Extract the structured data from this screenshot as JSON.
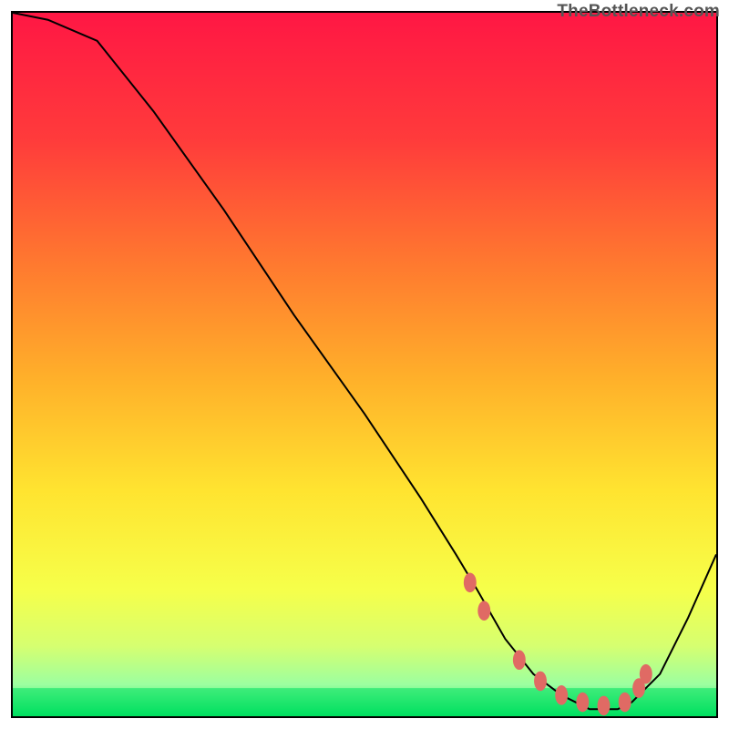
{
  "watermark": "TheBottleneck.com",
  "chart_data": {
    "type": "line",
    "title": "",
    "xlabel": "",
    "ylabel": "",
    "xlim": [
      0,
      100
    ],
    "ylim": [
      0,
      100
    ],
    "grid": false,
    "curve": {
      "name": "bottleneck-curve",
      "color": "#000000",
      "x": [
        0,
        5,
        12,
        20,
        30,
        40,
        50,
        58,
        63,
        66,
        70,
        74,
        78,
        82,
        86,
        88,
        92,
        96,
        100
      ],
      "y": [
        100,
        99,
        96,
        86,
        72,
        57,
        43,
        31,
        23,
        18,
        11,
        6,
        3,
        1,
        1,
        2,
        6,
        14,
        23
      ]
    },
    "highlight_band": {
      "name": "optimal-zone",
      "color": "#00e060",
      "y_range": [
        0,
        4
      ]
    },
    "markers": {
      "name": "sweet-spot-markers",
      "color": "#e06a64",
      "points": [
        {
          "x": 65,
          "y": 19
        },
        {
          "x": 67,
          "y": 15
        },
        {
          "x": 72,
          "y": 8
        },
        {
          "x": 75,
          "y": 5
        },
        {
          "x": 78,
          "y": 3
        },
        {
          "x": 81,
          "y": 2
        },
        {
          "x": 84,
          "y": 1.5
        },
        {
          "x": 87,
          "y": 2
        },
        {
          "x": 89,
          "y": 4
        },
        {
          "x": 90,
          "y": 6
        }
      ]
    },
    "gradient_stops": [
      {
        "offset": 0.0,
        "color": "#ff1744"
      },
      {
        "offset": 0.18,
        "color": "#ff3b3b"
      },
      {
        "offset": 0.36,
        "color": "#ff7a2f"
      },
      {
        "offset": 0.52,
        "color": "#ffb02a"
      },
      {
        "offset": 0.68,
        "color": "#ffe430"
      },
      {
        "offset": 0.82,
        "color": "#f6ff4a"
      },
      {
        "offset": 0.9,
        "color": "#d6ff70"
      },
      {
        "offset": 0.955,
        "color": "#9cffa0"
      },
      {
        "offset": 1.0,
        "color": "#00e060"
      }
    ]
  }
}
